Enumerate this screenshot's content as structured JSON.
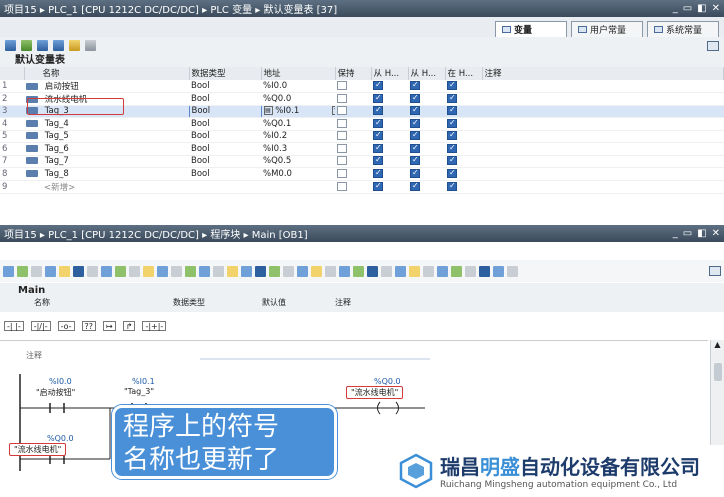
{
  "top_window": {
    "breadcrumb": "项目15 ▸ PLC_1 [CPU 1212C DC/DC/DC] ▸ PLC 变量 ▸ 默认变量表 [37]",
    "tabs": [
      "变量",
      "用户常量",
      "系统常量"
    ],
    "section_title": "默认变量表",
    "columns": [
      "名称",
      "数据类型",
      "地址",
      "保持",
      "从 H...",
      "从 H...",
      "在 H...",
      "注释"
    ],
    "rows": [
      {
        "num": "1",
        "name": "启动按钮",
        "type": "Bool",
        "addr": "%I0.0",
        "keep": false,
        "a": true,
        "b": true,
        "c": true
      },
      {
        "num": "2",
        "name": "流水线电机",
        "type": "Bool",
        "addr": "%Q0.0",
        "keep": false,
        "a": true,
        "b": true,
        "c": true
      },
      {
        "num": "3",
        "name": "Tag_3",
        "type": "Bool",
        "addr": "%I0.1",
        "keep": false,
        "a": true,
        "b": true,
        "c": true
      },
      {
        "num": "4",
        "name": "Tag_4",
        "type": "Bool",
        "addr": "%Q0.1",
        "keep": false,
        "a": true,
        "b": true,
        "c": true
      },
      {
        "num": "5",
        "name": "Tag_5",
        "type": "Bool",
        "addr": "%I0.2",
        "keep": false,
        "a": true,
        "b": true,
        "c": true
      },
      {
        "num": "6",
        "name": "Tag_6",
        "type": "Bool",
        "addr": "%I0.3",
        "keep": false,
        "a": true,
        "b": true,
        "c": true
      },
      {
        "num": "7",
        "name": "Tag_7",
        "type": "Bool",
        "addr": "%Q0.5",
        "keep": false,
        "a": true,
        "b": true,
        "c": true
      },
      {
        "num": "8",
        "name": "Tag_8",
        "type": "Bool",
        "addr": "%M0.0",
        "keep": false,
        "a": true,
        "b": true,
        "c": true
      },
      {
        "num": "9",
        "name": "<新增>",
        "type": "",
        "addr": "",
        "keep": false,
        "a": true,
        "b": true,
        "c": true
      }
    ]
  },
  "bottom_window": {
    "breadcrumb": "项目15 ▸ PLC_1 [CPU 1212C DC/DC/DC] ▸ 程序块 ▸ Main [OB1]",
    "block_title": "Main",
    "iface_cols": [
      "名称",
      "数据类型",
      "默认值",
      "注释"
    ],
    "ladder_elems": [
      "-| |-",
      "-|/|-",
      "-o-",
      "??",
      "↦",
      "↱",
      "-|+|-"
    ],
    "network_comment": "注释",
    "contacts": [
      {
        "addr": "%I0.0",
        "name": "\"启动按钮\""
      },
      {
        "addr": "%I0.1",
        "name": "\"Tag_3\""
      },
      {
        "addr": "%Q0.0",
        "name": "\"流水线电机\""
      },
      {
        "addr": "%Q0.0",
        "name": "\"流水线电机\""
      }
    ]
  },
  "bubble": {
    "line1": "程序上的符号",
    "line2": "名称也更新了"
  },
  "logo": {
    "cn_pre": "瑞昌",
    "cn_accent": "明盛",
    "cn_post": "自动化设备有限公司",
    "en": "Ruichang Mingsheng automation equipment Co., Ltd"
  },
  "colors": {
    "accent": "#4a90d9",
    "highlight": "#d33a3a",
    "brand": "#1d3b6b"
  }
}
